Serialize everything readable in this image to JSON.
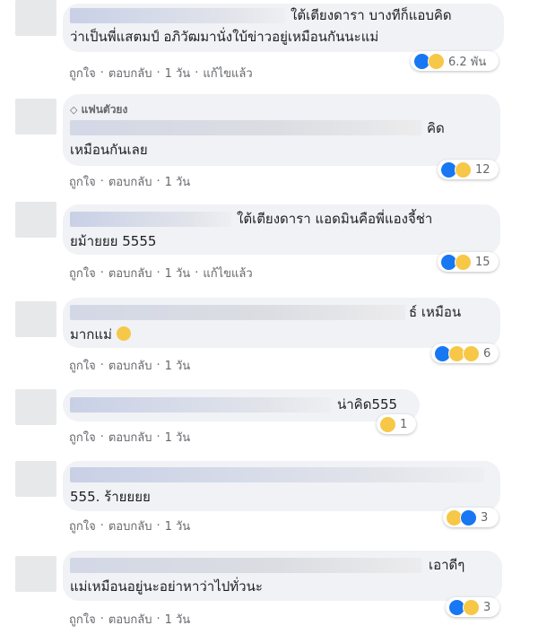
{
  "comments": [
    {
      "text_lines": [
        "ใต้เตียงดารา บางทีก็แอบคิด",
        "ว่าเป็นพี่แสตมป์ อภิวัฒมานั่งใบ้ข่าวอยู่เหมือนกันนะแม่"
      ],
      "actions": [
        "ถูกใจ",
        "ตอบกลับ",
        "1 วัน",
        "แก้ไขแล้ว"
      ],
      "reactions": {
        "icons": [
          "like",
          "haha"
        ],
        "count": "6.2 พัน"
      }
    },
    {
      "badge": "แฟนตัวยง",
      "text_lines": [
        "คิด",
        "เหมือนกันเลย"
      ],
      "actions": [
        "ถูกใจ",
        "ตอบกลับ",
        "1 วัน"
      ],
      "reactions": {
        "icons": [
          "like",
          "sad"
        ],
        "count": "12"
      }
    },
    {
      "text_lines": [
        "ใต้เตียงดารา แอดมินคือพี่แองจี้ช่า",
        "ยม้ายยย 5555"
      ],
      "actions": [
        "ถูกใจ",
        "ตอบกลับ",
        "1 วัน",
        "แก้ไขแล้ว"
      ],
      "reactions": {
        "icons": [
          "like",
          "haha"
        ],
        "count": "15"
      }
    },
    {
      "text_lines": [
        "ธ์ เหมือน",
        "มากแม่"
      ],
      "actions": [
        "ถูกใจ",
        "ตอบกลับ",
        "1 วัน"
      ],
      "reactions": {
        "icons": [
          "like",
          "wow",
          "sad"
        ],
        "count": "6"
      }
    },
    {
      "text_lines": [
        "น่าคิด555"
      ],
      "actions": [
        "ถูกใจ",
        "ตอบกลับ",
        "1 วัน"
      ],
      "reactions": {
        "icons": [
          "haha"
        ],
        "count": "1"
      }
    },
    {
      "text_lines": [
        "555. ร้ายยยย"
      ],
      "actions": [
        "ถูกใจ",
        "ตอบกลับ",
        "1 วัน"
      ],
      "reactions": {
        "icons": [
          "haha",
          "like"
        ],
        "count": "3"
      }
    },
    {
      "text_lines": [
        "เอาดีๆ",
        "แม่เหมือนอยู่นะอย่าหาว่าไปทั่วนะ"
      ],
      "actions": [
        "ถูกใจ",
        "ตอบกลับ",
        "1 วัน"
      ],
      "reactions": {
        "icons": [
          "like",
          "haha"
        ],
        "count": "3"
      }
    }
  ],
  "icons": {
    "reaction_colors": {
      "like": "#1877f2",
      "haha": "#f7c748",
      "sad": "#f7c748",
      "wow": "#f7c748"
    }
  },
  "colors": {
    "bubble": "#f0f2f5",
    "meta_text": "#65676b",
    "text": "#1c1e21"
  }
}
